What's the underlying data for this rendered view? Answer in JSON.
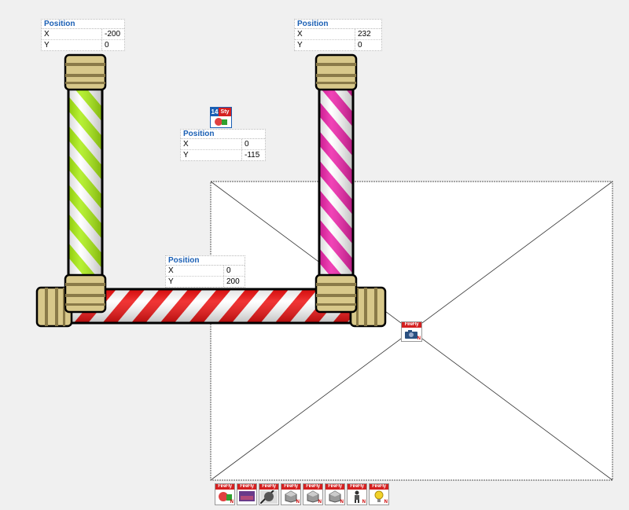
{
  "panels": {
    "left_pole": {
      "title": "Position",
      "x_label": "X",
      "x_value": "-200",
      "y_label": "Y",
      "y_value": "0"
    },
    "right_pole": {
      "title": "Position",
      "x_label": "X",
      "x_value": "232",
      "y_label": "Y",
      "y_value": "0"
    },
    "middle": {
      "title": "Position",
      "x_label": "X",
      "x_value": "0",
      "y_label": "Y",
      "y_value": "-115"
    },
    "crossbar": {
      "title": "Position",
      "x_label": "X",
      "x_value": "0",
      "y_label": "Y",
      "y_value": "200"
    }
  },
  "node_icon": {
    "number": "14",
    "tag": "Sty"
  },
  "toolbar": {
    "items": [
      {
        "header": "FireFly",
        "icon": "color-ball-icon"
      },
      {
        "header": "FireFly",
        "icon": "image-icon"
      },
      {
        "header": "FireFly",
        "icon": "sphere-icon"
      },
      {
        "header": "FireFly",
        "icon": "cube-icon"
      },
      {
        "header": "FireFly",
        "icon": "cube-icon"
      },
      {
        "header": "FireFly",
        "icon": "cube-icon"
      },
      {
        "header": "FireFly",
        "icon": "figure-icon"
      },
      {
        "header": "FireFly",
        "icon": "light-bulb-icon"
      }
    ]
  },
  "camera": {
    "header": "FireFly"
  },
  "colors": {
    "green_stripe": "#aaee11",
    "pink_stripe": "#ee22aa",
    "red_stripe": "#ee1111",
    "gold": "#d8c88a",
    "title_blue": "#1a5fb4"
  }
}
